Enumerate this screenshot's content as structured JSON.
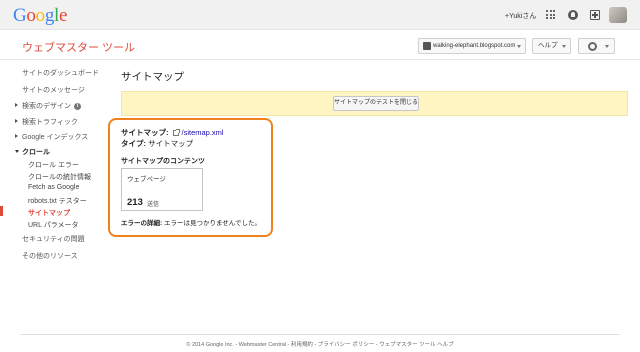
{
  "google_bar": {
    "logo": [
      "G",
      "o",
      "o",
      "g",
      "l",
      "e"
    ],
    "user_name": "+Yukiさん"
  },
  "header": {
    "product_title": "ウェブマスター ツール",
    "site_selector": "walking-elephant.blogspot.com",
    "help_label": "ヘルプ"
  },
  "sidebar": {
    "items": [
      "サイトのダッシュボード",
      "サイトのメッセージ",
      "検索のデザイン",
      "検索トラフィック",
      "Google インデックス",
      "クロール",
      "クロール エラー",
      "クロールの統計情報",
      "Fetch as Google",
      "robots.txt テスター",
      "サイトマップ",
      "URL パラメータ",
      "セキュリティの問題",
      "その他のリソース"
    ],
    "info_glyph": "i"
  },
  "main": {
    "page_title": "サイトマップ",
    "test_close_button": "サイトマップのテストを閉じる",
    "sitemap_label": "サイトマップ:",
    "sitemap_link": "/sitemap.xml",
    "type_label": "タイプ:",
    "type_value": "サイトマップ",
    "contents_title": "サイトマップのコンテンツ",
    "contents_type": "ウェブページ",
    "contents_count": "213",
    "contents_unit": "送信",
    "error_label": "エラーの詳細:",
    "error_value": "エラーは見つかりませんでした。"
  },
  "footer": {
    "text": "© 2014 Google Inc. - Webmaster Central - 利用規約 - プライバシー ポリシー - ウェブマスター ツール ヘルプ"
  },
  "colors": {
    "accent_red": "#dd4b39",
    "highlight_orange": "#f0821e",
    "banner_yellow": "#fff5c3",
    "link_blue": "#1a0dab"
  }
}
